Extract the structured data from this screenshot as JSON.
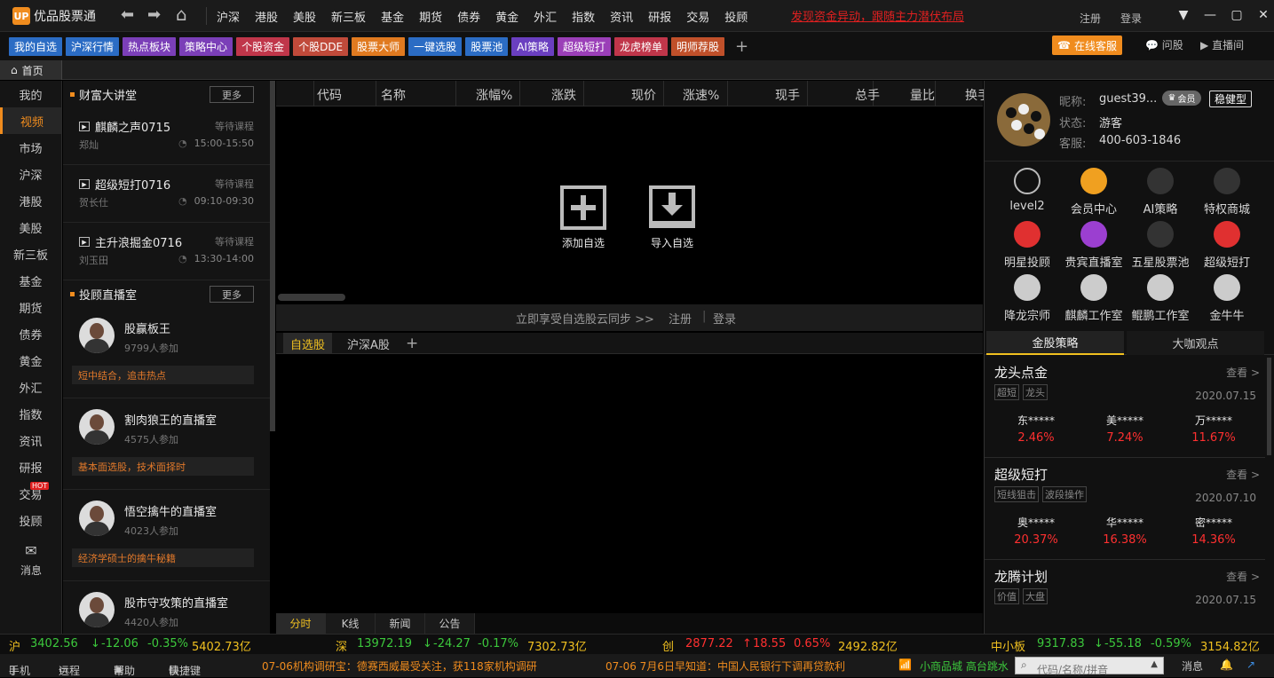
{
  "app": {
    "logo_mark": "UP",
    "title": "优品股票通"
  },
  "main_nav": [
    "沪深",
    "港股",
    "美股",
    "新三板",
    "基金",
    "期货",
    "债券",
    "黄金",
    "外汇",
    "指数",
    "资讯",
    "研报",
    "交易",
    "投顾"
  ],
  "banner": "发现资金异动，跟随主力潜伏布局",
  "account": {
    "register": "注册",
    "login": "登录"
  },
  "shortcuts": [
    {
      "label": "我的自选",
      "color": "#2b6cc4"
    },
    {
      "label": "沪深行情",
      "color": "#2b6cc4"
    },
    {
      "label": "热点板块",
      "color": "#7b3fb8"
    },
    {
      "label": "策略中心",
      "color": "#7b3fb8"
    },
    {
      "label": "个股资金",
      "color": "#c0364a"
    },
    {
      "label": "个股DDE",
      "color": "#c04a3a"
    },
    {
      "label": "股票大师",
      "color": "#e07a20"
    },
    {
      "label": "一键选股",
      "color": "#2b6cc4"
    },
    {
      "label": "股票池",
      "color": "#2b6cc4"
    },
    {
      "label": "AI策略",
      "color": "#6a3fc0"
    },
    {
      "label": "超级短打",
      "color": "#9b3fb8"
    },
    {
      "label": "龙虎榜单",
      "color": "#c0364a"
    },
    {
      "label": "明师荐股",
      "color": "#c0502a"
    }
  ],
  "service": {
    "online": "在线客服",
    "ask": "问股",
    "live": "直播间"
  },
  "home_tab": "首页",
  "left_nav": [
    {
      "label": "我的"
    },
    {
      "label": "视频",
      "active": true
    },
    {
      "label": "市场"
    },
    {
      "label": "沪深"
    },
    {
      "label": "港股"
    },
    {
      "label": "美股"
    },
    {
      "label": "新三板"
    },
    {
      "label": "基金"
    },
    {
      "label": "期货"
    },
    {
      "label": "债券"
    },
    {
      "label": "黄金"
    },
    {
      "label": "外汇"
    },
    {
      "label": "指数"
    },
    {
      "label": "资讯"
    },
    {
      "label": "研报"
    },
    {
      "label": "交易",
      "badge": "HOT"
    },
    {
      "label": "投顾"
    }
  ],
  "message_label": "消息",
  "lecture": {
    "title": "财富大讲堂",
    "more": "更多",
    "courses": [
      {
        "name": "麒麟之声0715",
        "teacher": "郑灿",
        "status": "等待课程",
        "time": "15:00-15:50"
      },
      {
        "name": "超级短打0716",
        "teacher": "贺长仕",
        "status": "等待课程",
        "time": "09:10-09:30"
      },
      {
        "name": "主升浪掘金0716",
        "teacher": "刘玉田",
        "status": "等待课程",
        "time": "13:30-14:00"
      }
    ]
  },
  "live_room": {
    "title": "投顾直播室",
    "more": "更多",
    "streamers": [
      {
        "name": "股赢板王",
        "count": "9799人参加",
        "desc": "短中结合，追击热点"
      },
      {
        "name": "割肉狼王的直播室",
        "count": "4575人参加",
        "desc": "基本面选股，技术面择时"
      },
      {
        "name": "悟空擒牛的直播室",
        "count": "4023人参加",
        "desc": "经济学硕士的擒牛秘籍"
      },
      {
        "name": "股市守攻策的直播室",
        "count": "4420人参加",
        "desc": ""
      }
    ]
  },
  "table_headers": [
    "代码",
    "名称",
    "涨幅%",
    "涨跌",
    "现价",
    "涨速%",
    "现手",
    "总手",
    "量比",
    "换手"
  ],
  "watch_actions": {
    "add": "添加自选",
    "import": "导入自选"
  },
  "sync": {
    "text": "立即享受自选股云同步 >>",
    "register": "注册",
    "login": "登录"
  },
  "sub_tabs": [
    "自选股",
    "沪深A股"
  ],
  "bottom_tabs": [
    "分时",
    "K线",
    "新闻",
    "公告"
  ],
  "user": {
    "nick_label": "昵称:",
    "nick": "guest39...",
    "vip": "会员",
    "type": "稳健型",
    "status_label": "状态:",
    "status": "游客",
    "service_label": "客服:",
    "service": "400-603-1846"
  },
  "features": [
    "level2",
    "会员中心",
    "AI策略",
    "特权商城",
    "明星投顾",
    "贵宾直播室",
    "五星股票池",
    "超级短打",
    "降龙宗师",
    "麒麟工作室",
    "鲲鹏工作室",
    "金牛牛"
  ],
  "right_tabs": [
    "金股策略",
    "大咖观点"
  ],
  "strategies": [
    {
      "name": "龙头点金",
      "view": "查看 >",
      "tags": [
        "超短",
        "龙头"
      ],
      "date": "2020.07.15",
      "stocks": [
        {
          "name": "东*****",
          "pct": "2.46%"
        },
        {
          "name": "美*****",
          "pct": "7.24%"
        },
        {
          "name": "万*****",
          "pct": "11.67%"
        }
      ]
    },
    {
      "name": "超级短打",
      "view": "查看 >",
      "tags": [
        "短线狙击",
        "波段操作"
      ],
      "date": "2020.07.10",
      "stocks": [
        {
          "name": "奥*****",
          "pct": "20.37%"
        },
        {
          "name": "华*****",
          "pct": "16.38%"
        },
        {
          "name": "密*****",
          "pct": "14.36%"
        }
      ]
    },
    {
      "name": "龙腾计划",
      "view": "查看 >",
      "tags": [
        "价值",
        "大盘"
      ],
      "date": "2020.07.15",
      "stocks": []
    }
  ],
  "indices": [
    {
      "name": "沪",
      "price": "3402.56",
      "chg": "-12.06",
      "pct": "-0.35%",
      "amt": "5402.73亿",
      "dir": "down"
    },
    {
      "name": "深",
      "price": "13972.19",
      "chg": "-24.27",
      "pct": "-0.17%",
      "amt": "7302.73亿",
      "dir": "down"
    },
    {
      "name": "创",
      "price": "2877.22",
      "chg": "18.55",
      "pct": "0.65%",
      "amt": "2492.82亿",
      "dir": "up"
    },
    {
      "name": "中小板",
      "price": "9317.83",
      "chg": "-55.18",
      "pct": "-0.59%",
      "amt": "3154.82亿",
      "dir": "down"
    }
  ],
  "statusbar": {
    "phone": "手机",
    "remote": "远程",
    "help": "帮助",
    "hotkey": "快捷键",
    "news1": "07-06机构调研宝：德赛西威最受关注，获118家机构调研",
    "news2": "07-06 7月6日早知道：中国人民银行下调再贷款利",
    "ticker": "小商品城 高台跳水",
    "search_placeholder": "代码/名称/拼音",
    "msg": "消息"
  }
}
